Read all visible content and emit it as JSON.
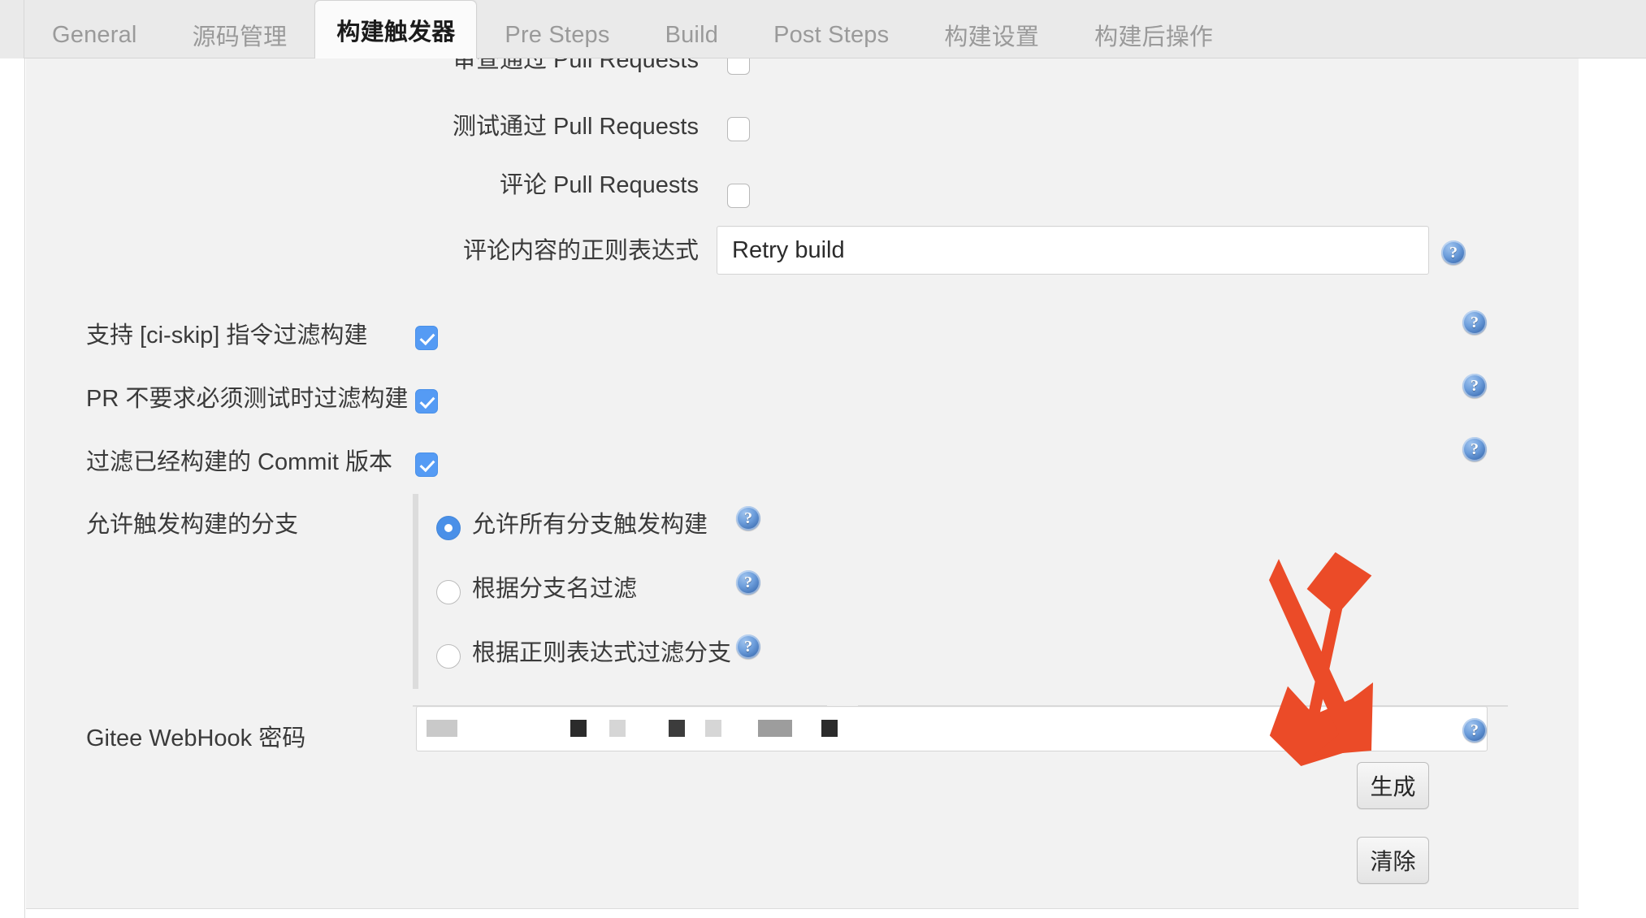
{
  "tabs": [
    {
      "label": "General",
      "active": false
    },
    {
      "label": "源码管理",
      "active": false
    },
    {
      "label": "构建触发器",
      "active": true
    },
    {
      "label": "Pre Steps",
      "active": false
    },
    {
      "label": "Build",
      "active": false
    },
    {
      "label": "Post Steps",
      "active": false
    },
    {
      "label": "构建设置",
      "active": false
    },
    {
      "label": "构建后操作",
      "active": false
    }
  ],
  "form": {
    "clipped_row": {
      "label": "审查通过 Pull Requests",
      "checked": false
    },
    "checkbox_rows": [
      {
        "label": "测试通过 Pull Requests",
        "checked": false
      },
      {
        "label": "评论 Pull Requests",
        "checked": false
      }
    ],
    "comment_regex": {
      "label": "评论内容的正则表达式",
      "value": "Retry build",
      "placeholder": ""
    },
    "toggle_rows": [
      {
        "label": "支持 [ci-skip] 指令过滤构建",
        "checked": true
      },
      {
        "label": "PR 不要求必须测试时过滤构建",
        "checked": true
      },
      {
        "label": "过滤已经构建的 Commit 版本",
        "checked": true
      }
    ],
    "branch_group": {
      "label": "允许触发构建的分支",
      "options": [
        {
          "label": "允许所有分支触发构建",
          "selected": true
        },
        {
          "label": "根据分支名过滤",
          "selected": false
        },
        {
          "label": "根据正则表达式过滤分支",
          "selected": false
        }
      ]
    },
    "webhook_password": {
      "label": "Gitee WebHook 密码",
      "value": "",
      "masked": true
    },
    "buttons": {
      "generate": "生成",
      "clear": "清除"
    },
    "help_icon_name": "help-question-icon",
    "help_icon_glyph": "?"
  },
  "annotation": {
    "arrow_color": "#eb4b28",
    "points_to": "生成"
  },
  "colors": {
    "accent_checkbox": "#559bf4",
    "accent_radio": "#4a90e8",
    "panel_bg": "#f2f2f2",
    "tabbar_bg": "#eaeaea",
    "active_tab_bg": "#fbfbfb",
    "text": "#3a3a3a",
    "muted_text": "#9a9a9a"
  }
}
